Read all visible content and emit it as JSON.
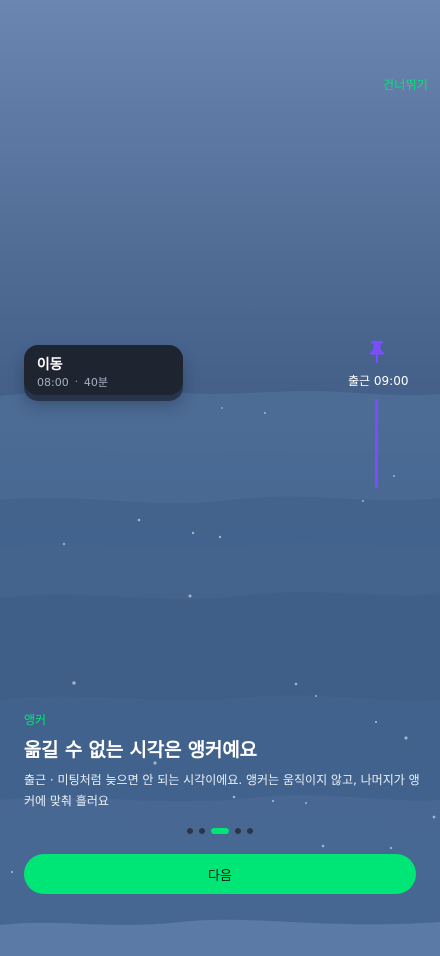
{
  "header": {
    "skip_label": "건너뛰기"
  },
  "timeline": {
    "card": {
      "title": "이동",
      "time": "08:00",
      "separator": "·",
      "duration": "40분"
    },
    "anchor": {
      "icon": "pushpin-icon",
      "label": "출근 09:00"
    }
  },
  "onboarding": {
    "tag": "앵커",
    "headline": "옮길 수 없는 시각은 앵커예요",
    "description": "출근 · 미팅처럼 늦으면 안 되는 시각이에요. 앵커는 움직이지 않고, 나머지가 앵커에 맞춰 흘러요",
    "pager": {
      "total": 5,
      "current": 3
    },
    "next_label": "다음"
  },
  "colors": {
    "accent": "#00e676",
    "anchor": "#7c4dff",
    "card": "#1f2431"
  }
}
